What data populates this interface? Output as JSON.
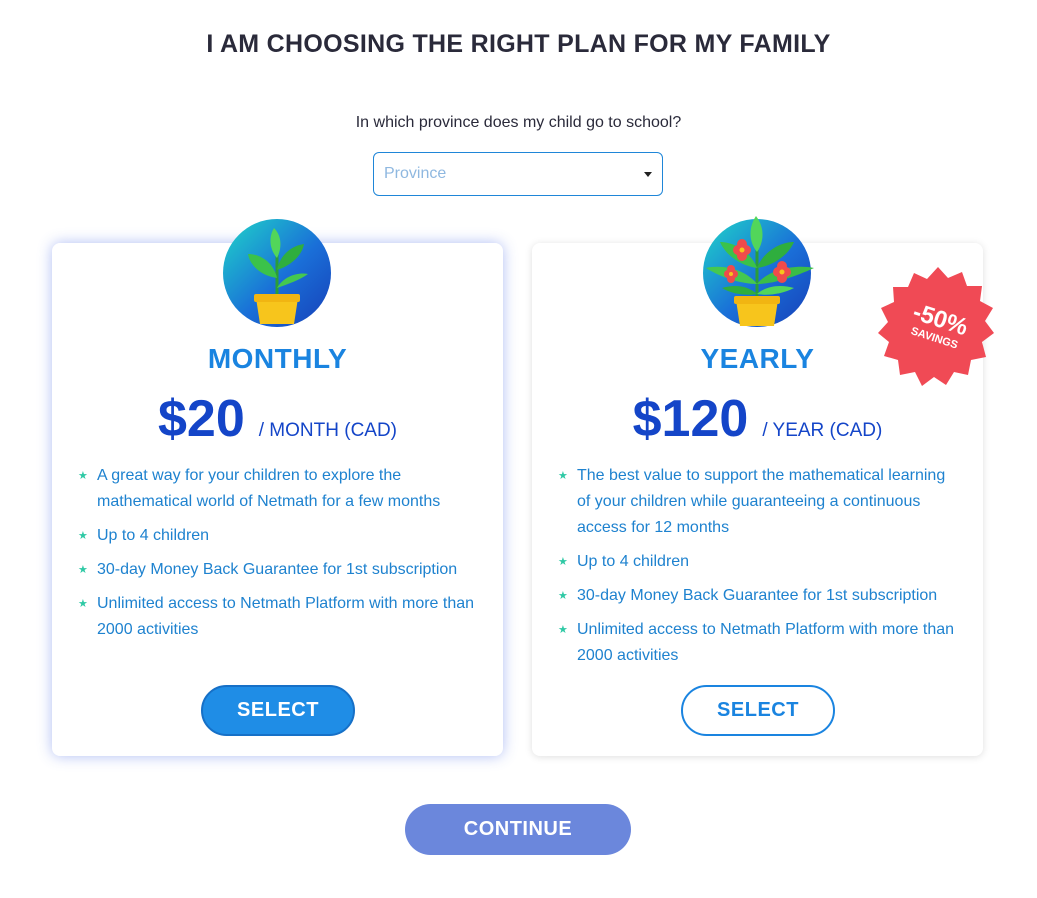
{
  "page": {
    "title": "I AM CHOOSING THE RIGHT PLAN FOR MY FAMILY",
    "question": "In which province does my child go to school?",
    "province_placeholder": "Province"
  },
  "plans": [
    {
      "name": "MONTHLY",
      "price": "$20",
      "period": "/ MONTH (CAD)",
      "selected": true,
      "features": [
        "A great way for your children to explore the mathematical world of Netmath for a few months",
        "Up to 4 children",
        "30-day Money Back Guarantee for 1st subscription",
        "Unlimited access to Netmath Platform with more than 2000 activities"
      ],
      "select_label": "SELECT"
    },
    {
      "name": "YEARLY",
      "price": "$120",
      "period": "/ YEAR (CAD)",
      "selected": false,
      "features": [
        "The best value to support the mathematical learning of your children while guaranteeing a continuous access for 12 months",
        "Up to 4 children",
        "30-day Money Back Guarantee for 1st subscription",
        "Unlimited access to Netmath Platform with more than 2000 activities"
      ],
      "select_label": "SELECT",
      "badge": {
        "big": "-50%",
        "small": "SAVINGS"
      }
    }
  ],
  "continue_label": "CONTINUE",
  "icons": {
    "monthly": "potted-plant-icon",
    "yearly": "flowering-plant-icon",
    "bullet": "star-bullet-icon",
    "dropdown": "caret-down-icon"
  },
  "colors": {
    "accent": "#1a84e0",
    "price": "#1445c8",
    "bullet": "#2fc9a5",
    "badge": "#f04a55",
    "continue": "#6b87dc",
    "title": "#2a2a3a"
  }
}
